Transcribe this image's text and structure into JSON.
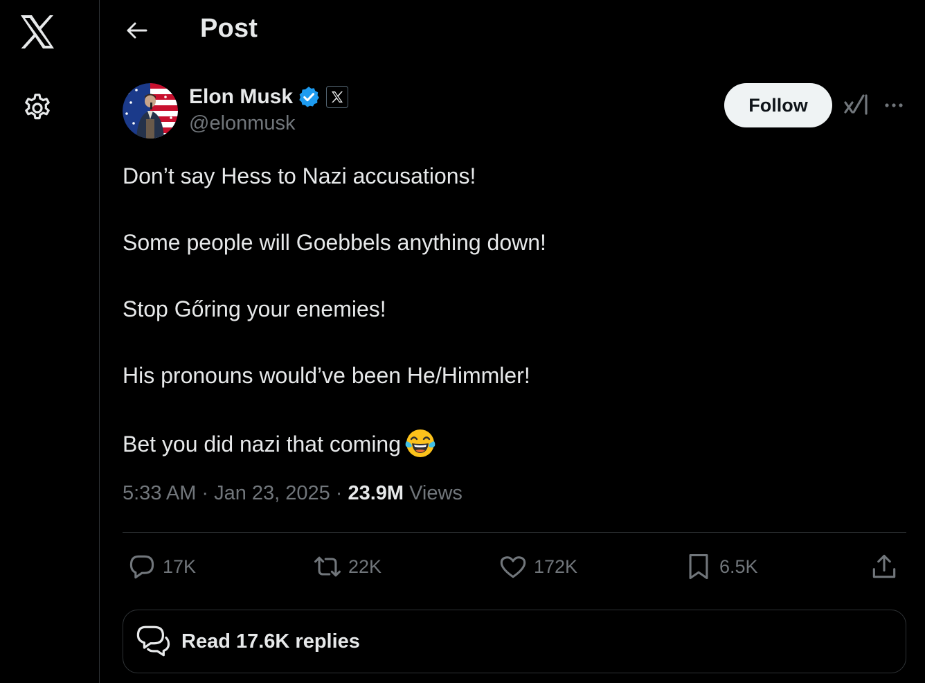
{
  "header": {
    "title": "Post"
  },
  "author": {
    "name": "Elon Musk",
    "handle": "@elonmusk"
  },
  "follow_label": "Follow",
  "tweet": {
    "lines": [
      "Don’t say Hess to Nazi accusations!",
      "Some people will Goebbels anything down!",
      "Stop Gőring your enemies!",
      "His pronouns would’ve been He/Himmler!",
      "Bet you did nazi that coming"
    ],
    "emoji": "face-with-tears-of-joy"
  },
  "meta": {
    "time": "5:33 AM",
    "date": "Jan 23, 2025",
    "views_count": "23.9M",
    "views_label": "Views"
  },
  "actions": {
    "replies": "17K",
    "reposts": "22K",
    "likes": "172K",
    "bookmarks": "6.5K"
  },
  "read_replies_label": "Read 17.6K replies",
  "icons": {
    "logo": "x-logo-icon",
    "settings": "gear-icon",
    "back": "arrow-left-icon",
    "verified": "verified-badge-icon",
    "affiliate": "x-affiliate-icon",
    "grok": "grok-icon",
    "more": "more-icon",
    "reply": "reply-icon",
    "repost": "repost-icon",
    "like": "heart-icon",
    "bookmark": "bookmark-icon",
    "share": "share-icon"
  },
  "colors": {
    "background": "#000000",
    "text": "#e7e9ea",
    "secondary": "#71767b",
    "border": "#2f3336",
    "verified": "#1d9bf0",
    "follow_bg": "#eff3f4"
  }
}
